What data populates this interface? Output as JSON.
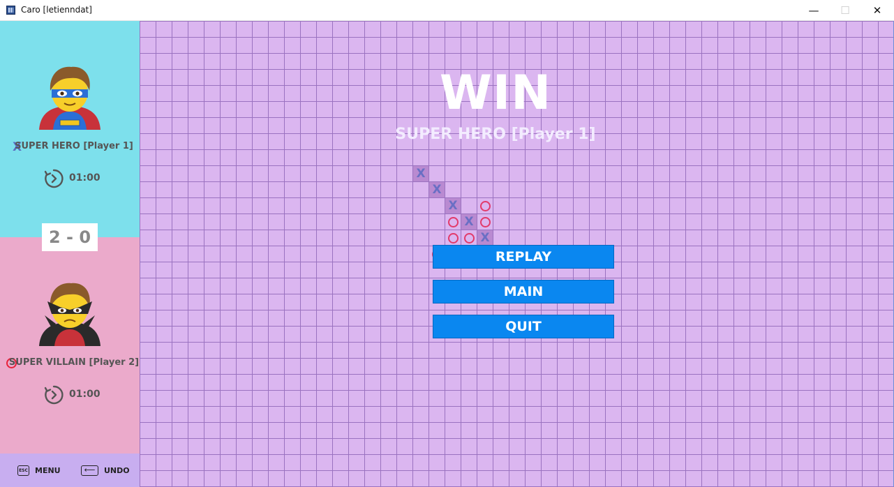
{
  "window": {
    "title": "Caro [letienndat]",
    "minimize_glyph": "—",
    "maximize_glyph": "☐",
    "close_glyph": "✕"
  },
  "players": {
    "p1": {
      "name": "SUPER HERO [Player 1]",
      "mark": "X",
      "time": "01:00",
      "avatar": "superhero-icon",
      "panel_color": "#7de0ec"
    },
    "p2": {
      "name": "SUPER VILLAIN [Player 2]",
      "mark": "O",
      "time": "01:00",
      "avatar": "supervillain-icon",
      "panel_color": "#ebaacb"
    }
  },
  "score": "2 - 0",
  "controls": {
    "menu_key": "ESC",
    "menu_label": "MENU",
    "undo_key": "⟵",
    "undo_label": "UNDO"
  },
  "board": {
    "cell_size_note": "grid of squares",
    "colors": {
      "background": "#dbb6f0",
      "grid": "#9a72c0",
      "x": "#6a6fc4",
      "o": "#e23a6a",
      "highlight": "#b98ad1"
    },
    "pieces": [
      {
        "col": 17,
        "row": 9,
        "mark": "X",
        "win": true
      },
      {
        "col": 18,
        "row": 10,
        "mark": "X",
        "win": true
      },
      {
        "col": 19,
        "row": 11,
        "mark": "X",
        "win": true
      },
      {
        "col": 21,
        "row": 11,
        "mark": "O",
        "win": false
      },
      {
        "col": 19,
        "row": 12,
        "mark": "O",
        "win": false
      },
      {
        "col": 20,
        "row": 12,
        "mark": "X",
        "win": true
      },
      {
        "col": 21,
        "row": 12,
        "mark": "O",
        "win": false
      },
      {
        "col": 19,
        "row": 13,
        "mark": "O",
        "win": false
      },
      {
        "col": 20,
        "row": 13,
        "mark": "O",
        "win": false
      },
      {
        "col": 21,
        "row": 13,
        "mark": "X",
        "win": true
      },
      {
        "col": 18,
        "row": 14,
        "mark": "O",
        "win": false
      }
    ]
  },
  "result": {
    "title": "WIN",
    "winner": "SUPER HERO [Player 1]"
  },
  "menu": {
    "replay": "REPLAY",
    "main": "MAIN",
    "quit": "QUIT",
    "button_color": "#0a87f0"
  }
}
